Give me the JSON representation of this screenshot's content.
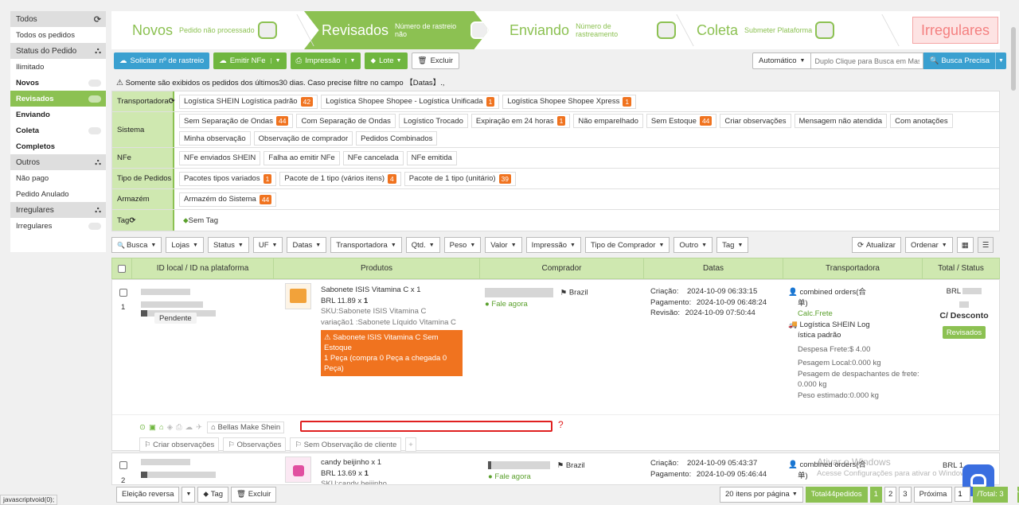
{
  "sidebar": {
    "groups": [
      {
        "header": "Todos",
        "icon": "refresh-icon",
        "items": [
          {
            "label": "Todos os pedidos",
            "bold": false,
            "active": false,
            "pill": false
          }
        ]
      },
      {
        "header": "Status do Pedido",
        "icon": "sitemap-icon",
        "items": [
          {
            "label": "Ilimitado",
            "bold": false,
            "active": false,
            "pill": false
          },
          {
            "label": "Novos",
            "bold": true,
            "active": false,
            "pill": true
          },
          {
            "label": "Revisados",
            "bold": true,
            "active": true,
            "pill": true
          },
          {
            "label": "Enviando",
            "bold": true,
            "active": false,
            "pill": false
          },
          {
            "label": "Coleta",
            "bold": true,
            "active": false,
            "pill": true
          },
          {
            "label": "Completos",
            "bold": true,
            "active": false,
            "pill": false
          }
        ]
      },
      {
        "header": "Outros",
        "icon": "sitemap-icon",
        "items": [
          {
            "label": "Não pago",
            "bold": false,
            "active": false,
            "pill": false
          },
          {
            "label": "Pedido Anulado",
            "bold": false,
            "active": false,
            "pill": false
          }
        ]
      },
      {
        "header": "Irregulares",
        "icon": "sitemap-icon",
        "items": [
          {
            "label": "Irregulares",
            "bold": false,
            "active": false,
            "pill": true
          }
        ]
      }
    ]
  },
  "steps": [
    {
      "name": "Novos",
      "sub": "Pedido não processado",
      "active": false
    },
    {
      "name": "Revisados",
      "sub": "Número de rastreio não",
      "active": true
    },
    {
      "name": "Enviando",
      "sub": "Número de rastreamento",
      "active": false
    },
    {
      "name": "Coleta",
      "sub": "Submeter Plataforma",
      "active": false
    }
  ],
  "irregular_tab": "Irregulares",
  "toolbar": {
    "request_tracking": "Solicitar nº de rastreio",
    "emit_nfe": "Emitir NFe",
    "print": "Impressão",
    "batch": "Lote",
    "delete": "Excluir",
    "mode": "Automático",
    "search_placeholder": "Duplo Clique para Busca em Mass",
    "precise_search": "Busca Precisa"
  },
  "notice": "Somente são exibidos os pedidos dos últimos30 dias. Caso precise filtre no campo 【Datas】.,",
  "filters": [
    {
      "label": "Transportadora",
      "chips": [
        {
          "text": "Logística SHEIN Logística padrão",
          "count": "42"
        },
        {
          "text": "Logística Shopee Shopee - Logística Unificada",
          "count": "1"
        },
        {
          "text": "Logística Shopee Shopee Xpress",
          "count": "1"
        }
      ]
    },
    {
      "label": "Sistema",
      "chips": [
        {
          "text": "Sem Separação de Ondas",
          "count": "44"
        },
        {
          "text": "Com Separação de Ondas",
          "count": ""
        },
        {
          "text": "Logístico Trocado",
          "count": ""
        },
        {
          "text": "Expiração em 24 horas",
          "count": "1"
        },
        {
          "text": "Não emparelhado",
          "count": ""
        },
        {
          "text": "Sem Estoque",
          "count": "44"
        },
        {
          "text": "Criar observações",
          "count": ""
        },
        {
          "text": "Mensagem não atendida",
          "count": ""
        },
        {
          "text": "Com anotações",
          "count": ""
        },
        {
          "text": "Minha observação",
          "count": ""
        },
        {
          "text": "Observação de comprador",
          "count": ""
        },
        {
          "text": "Pedidos Combinados",
          "count": ""
        }
      ]
    },
    {
      "label": "NFe",
      "chips": [
        {
          "text": "NFe enviados SHEIN",
          "count": ""
        },
        {
          "text": "Falha ao emitir NFe",
          "count": ""
        },
        {
          "text": "NFe cancelada",
          "count": ""
        },
        {
          "text": "NFe emitida",
          "count": ""
        }
      ]
    },
    {
      "label": "Tipo de Pedidos",
      "chips": [
        {
          "text": "Pacotes tipos variados",
          "count": "1"
        },
        {
          "text": "Pacote de 1 tipo (vários itens)",
          "count": "4"
        },
        {
          "text": "Pacote de 1 tipo (unitário)",
          "count": "39"
        }
      ]
    },
    {
      "label": "Armazém",
      "chips": [
        {
          "text": "Armazém do Sistema",
          "count": "44"
        }
      ]
    },
    {
      "label": "Tag",
      "chips": [
        {
          "text": "Sem Tag",
          "count": ""
        }
      ]
    }
  ],
  "controls": [
    "Busca",
    "Lojas",
    "Status",
    "UF",
    "Datas",
    "Transportadora",
    "Qtd.",
    "Peso",
    "Valor",
    "Impressão",
    "Tipo de Comprador",
    "Outro",
    "Tag"
  ],
  "controls_right": {
    "refresh": "Atualizar",
    "sort": "Ordenar"
  },
  "table_headers": [
    "ID local / ID na plataforma",
    "Produtos",
    "Comprador",
    "Datas",
    "Transportadora",
    "Total / Status"
  ],
  "orders": [
    {
      "index": "1",
      "status_pill": "Pendente",
      "product_title": "Sabonete ISIS Vitamina C x 1",
      "price": "BRL 11.89 x",
      "qty": "1",
      "sku": "SKU:Sabonete ISIS Vitamina C",
      "variation": "variação1 :Sabonete Líquido Vitamina C",
      "warning_line1": "Sabonete ISIS Vitamina C Sem Estoque",
      "warning_line2": "1 Peça (compra 0 Peça a chegada 0 Peça)",
      "country": "Brazil",
      "chat": "Fale agora",
      "created_label": "Criação:",
      "created": "2024-10-09 06:33:15",
      "paid_label": "Pagamento:",
      "paid": "2024-10-09 06:48:24",
      "review_label": "Revisão:",
      "review": "2024-10-09 07:50:44",
      "combined": "combined orders(合",
      "combined2": "单)",
      "calc": "Calc.Frete",
      "carrier_line1": "Logística SHEIN Log",
      "carrier_line2": "ística padrão",
      "freight": "Despesa Frete:$ 4.00",
      "weight_local": "Pesagem Local:0.000 kg",
      "weight_dispatch1": "Pesagem de despachantes de frete:",
      "weight_dispatch2": "0.000 kg",
      "weight_est": "Peso estimado:0.000 kg",
      "currency": "BRL",
      "discount": "C/ Desconto",
      "status": "Revisados",
      "store": "Bellas Make Shein",
      "note_create": "Criar observações",
      "note_obs": "Observações",
      "note_buyer": "Sem Observação de cliente"
    },
    {
      "index": "2",
      "product_title": "candy beijinho x 1",
      "price": "BRL 13.69 x",
      "qty": "1",
      "sku": "SKU:candy beijinho",
      "country": "Brazil",
      "chat": "Fale agora",
      "created_label": "Criação:",
      "created": "2024-10-09 05:43:37",
      "paid_label": "Pagamento:",
      "paid": "2024-10-09 05:46:44",
      "combined": "combined orders(合",
      "combined2": "单)",
      "currency": "BRL 1"
    }
  ],
  "footer": {
    "invert": "Eleição reversa",
    "tag": "Tag",
    "delete": "Excluir",
    "per_page": "20 itens por página",
    "total": "Total44pedidos",
    "pages": [
      "1",
      "2",
      "3"
    ],
    "next": "Próxima",
    "page_input": "1",
    "total_pages": "/Total: 3",
    "status_url": "javascriptvoid(0);"
  },
  "watermark": {
    "line1": "Ativar o Windows",
    "line2": "Acesse Configurações para ativar o Windows."
  }
}
